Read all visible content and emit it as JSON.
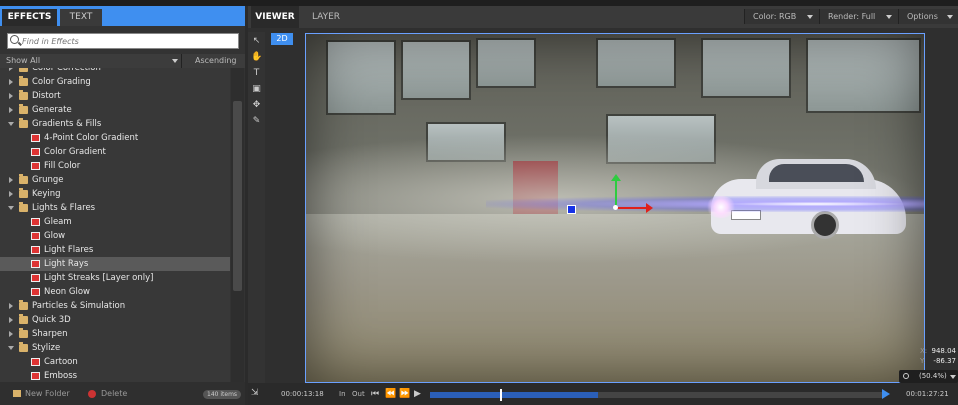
{
  "left_panel": {
    "tabs": {
      "effects": "EFFECTS",
      "text": "TEXT"
    },
    "search": {
      "placeholder": "Find in Effects"
    },
    "filter": {
      "show_all": "Show All",
      "sort": "Ascending"
    },
    "tree": [
      {
        "type": "cat",
        "state": "closed",
        "label": "Color Correction",
        "partial": true
      },
      {
        "type": "cat",
        "state": "closed",
        "label": "Color Grading"
      },
      {
        "type": "cat",
        "state": "closed",
        "label": "Distort"
      },
      {
        "type": "cat",
        "state": "closed",
        "label": "Generate"
      },
      {
        "type": "cat",
        "state": "open",
        "label": "Gradients & Fills"
      },
      {
        "type": "item",
        "label": "4-Point Color Gradient"
      },
      {
        "type": "item",
        "label": "Color Gradient"
      },
      {
        "type": "item",
        "label": "Fill Color"
      },
      {
        "type": "cat",
        "state": "closed",
        "label": "Grunge"
      },
      {
        "type": "cat",
        "state": "closed",
        "label": "Keying"
      },
      {
        "type": "cat",
        "state": "open",
        "label": "Lights & Flares"
      },
      {
        "type": "item",
        "label": "Gleam"
      },
      {
        "type": "item",
        "label": "Glow"
      },
      {
        "type": "item",
        "label": "Light Flares"
      },
      {
        "type": "item",
        "label": "Light Rays",
        "selected": true
      },
      {
        "type": "item",
        "label": "Light Streaks [Layer only]"
      },
      {
        "type": "item",
        "label": "Neon Glow"
      },
      {
        "type": "cat",
        "state": "closed",
        "label": "Particles & Simulation"
      },
      {
        "type": "cat",
        "state": "closed",
        "label": "Quick 3D"
      },
      {
        "type": "cat",
        "state": "closed",
        "label": "Sharpen"
      },
      {
        "type": "cat",
        "state": "open",
        "label": "Stylize"
      },
      {
        "type": "item",
        "label": "Cartoon"
      },
      {
        "type": "item",
        "label": "Emboss"
      }
    ],
    "bottom": {
      "new_folder": "New Folder",
      "delete": "Delete",
      "count": "140 items"
    }
  },
  "viewer": {
    "tabs": {
      "viewer": "VIEWER",
      "layer": "LAYER"
    },
    "color_mode": "Color: RGB",
    "render_mode": "Render: Full",
    "options": "Options",
    "mode_badge": "2D",
    "coords": {
      "x_label": "X:",
      "x": "948.04",
      "y_label": "Y:",
      "y": "-86.37"
    },
    "zoom": "(50.4%)"
  },
  "timeline": {
    "current_time": "00:00:13:18",
    "in_label": "In",
    "out_label": "Out",
    "total_time": "00:01:27:21",
    "playhead_fraction": 0.155
  },
  "colors": {
    "accent": "#3f8ff0",
    "selected_row": "#5a5a5a"
  },
  "icons": [
    "search-icon",
    "folder-icon",
    "effect-icon",
    "arrow-tool-icon",
    "hand-tool-icon",
    "text-tool-icon",
    "crop-tool-icon",
    "move-tool-icon",
    "pen-tool-icon",
    "snap-icon",
    "play-icon",
    "zoom-icon"
  ]
}
